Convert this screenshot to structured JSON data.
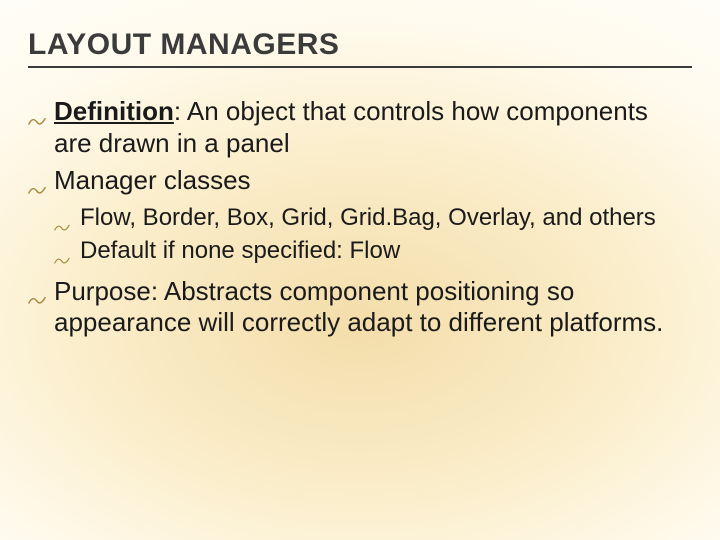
{
  "title": "LAYOUT MANAGERS",
  "items": {
    "definition": {
      "lead": "Definition",
      "rest": ": An object that controls how components are drawn in a panel"
    },
    "manager_classes": {
      "lead": "Manager classes",
      "sub": {
        "list": "Flow, Border, Box, Grid, Grid.Bag, Overlay, and others",
        "default": "Default if none specified: Flow"
      }
    },
    "purpose": {
      "lead": "Purpose: Abstracts component positioning so appearance will correctly adapt to different platforms."
    }
  }
}
